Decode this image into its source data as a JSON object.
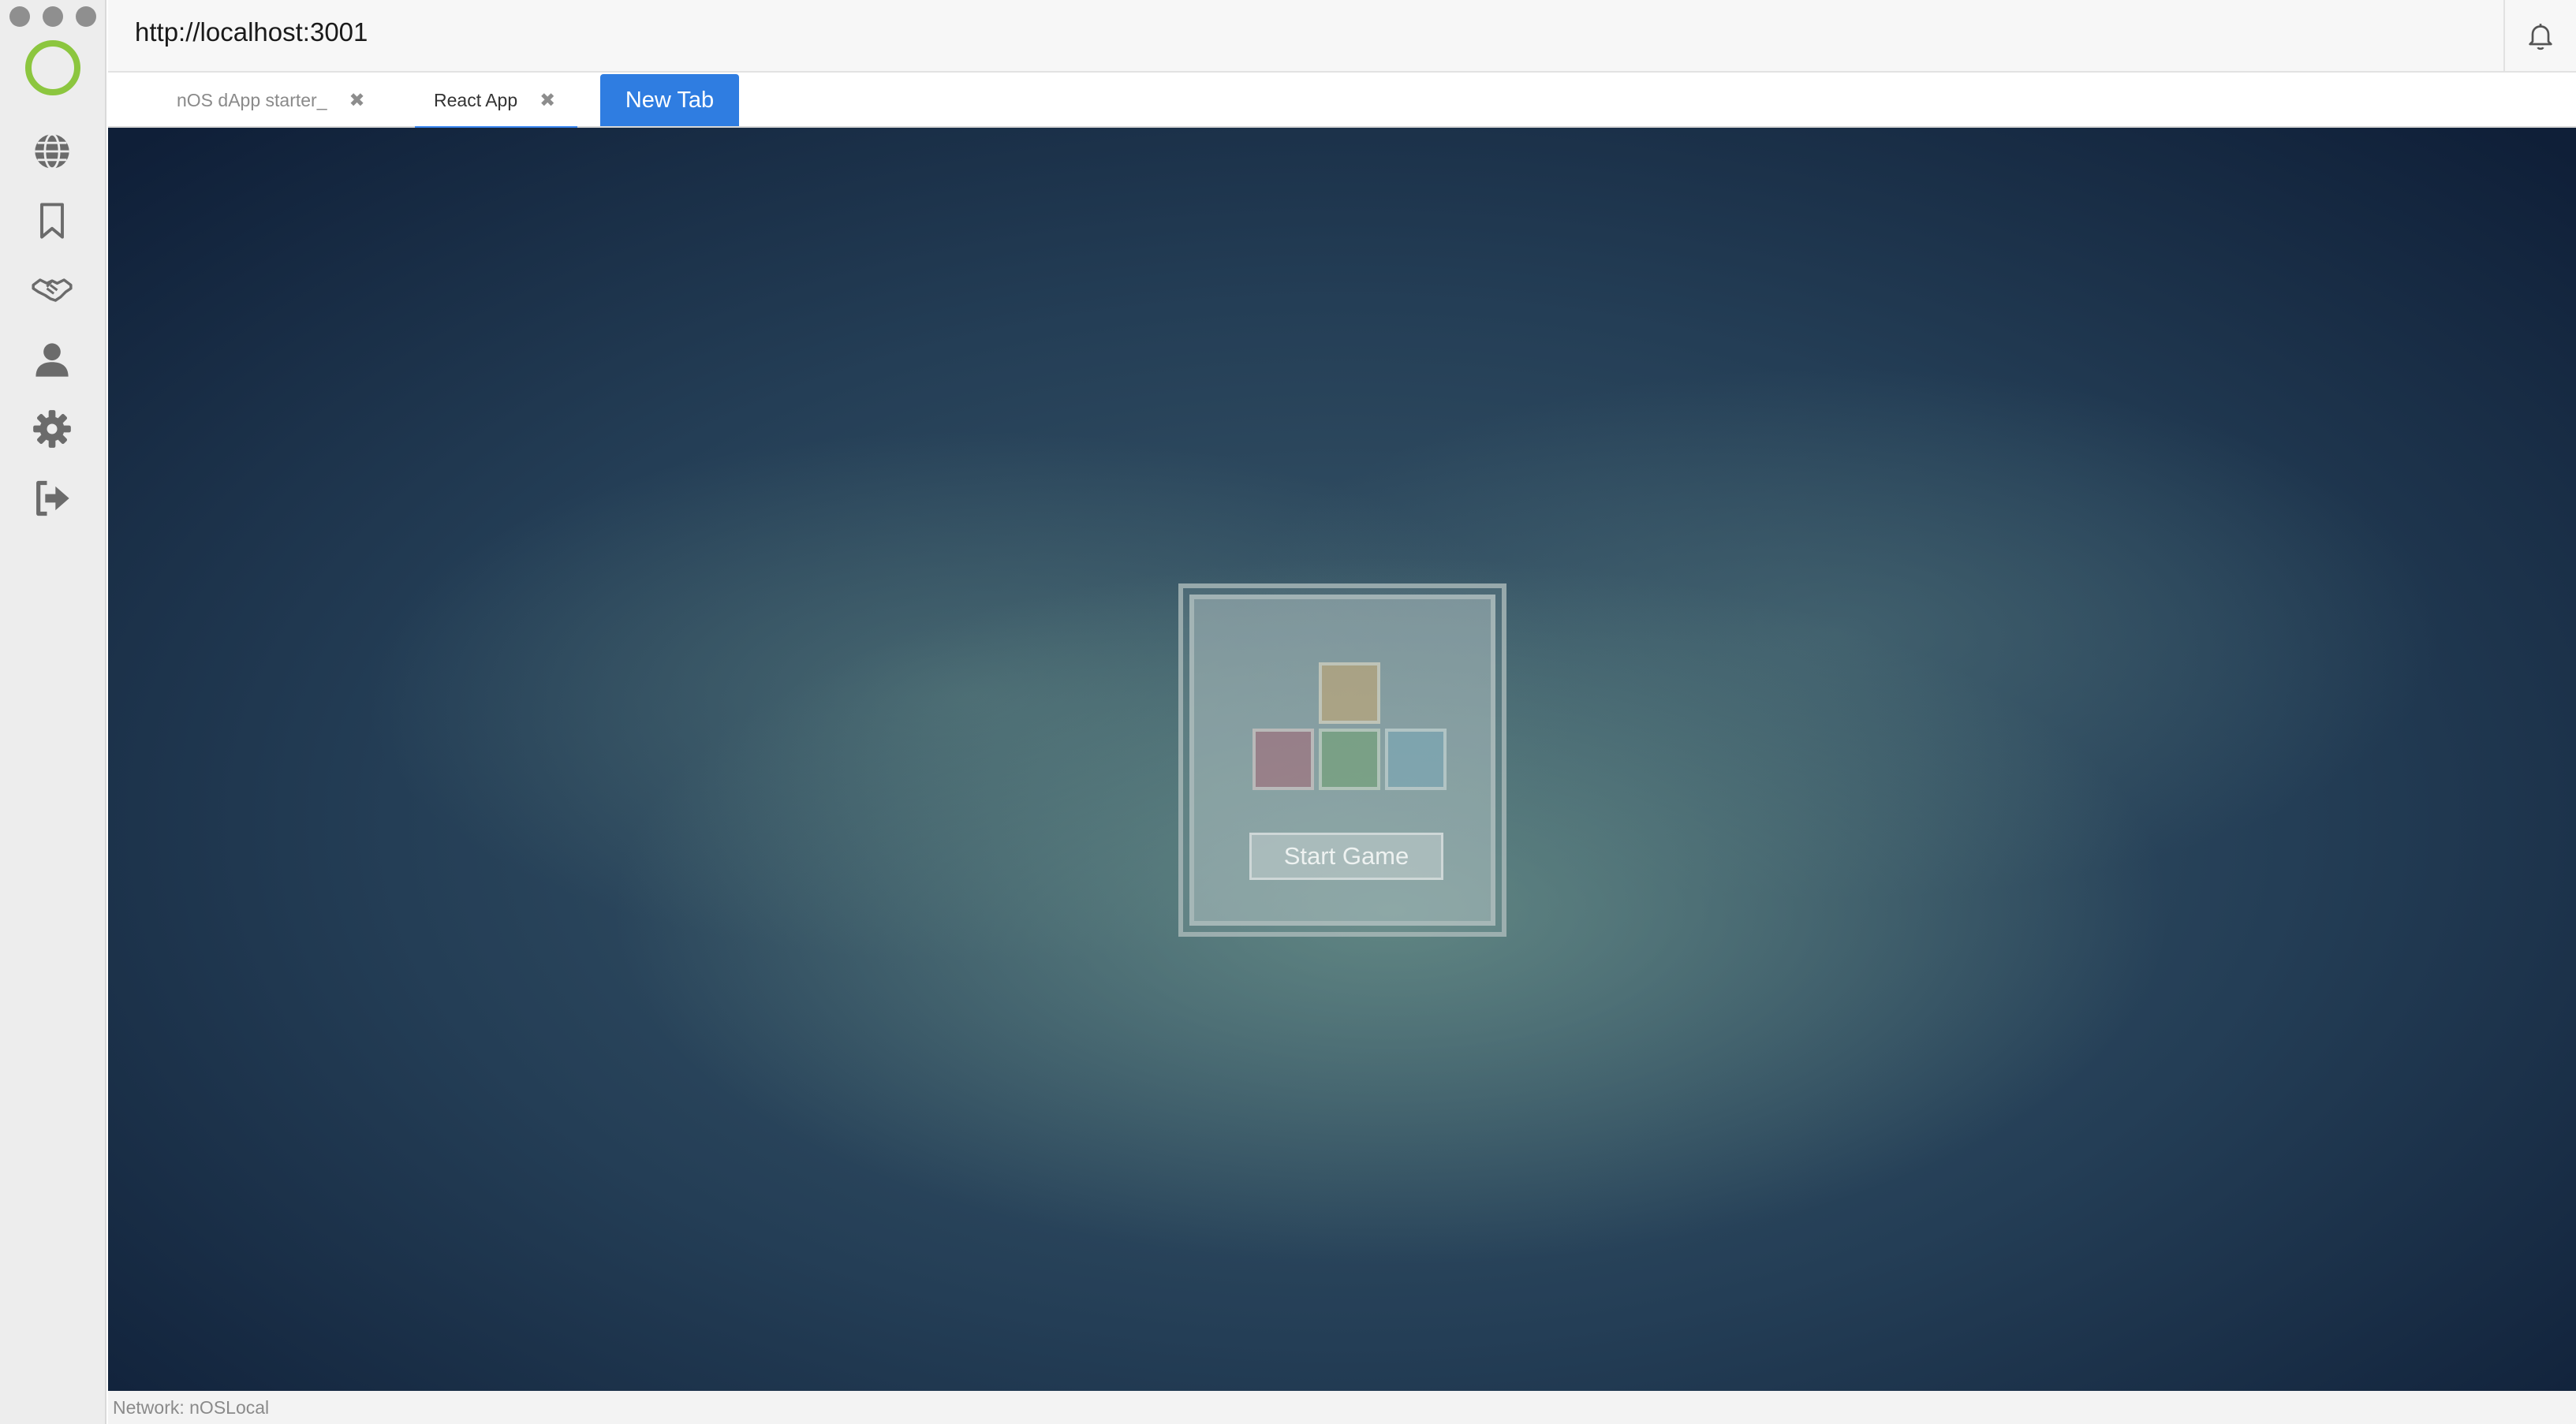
{
  "window": {
    "address": "http://localhost:3001"
  },
  "sidebar": {
    "logo_color": "#8cc63f",
    "icons": [
      "globe-icon",
      "bookmark-icon",
      "handshake-icon",
      "user-icon",
      "gear-icon",
      "logout-icon"
    ]
  },
  "tabs": [
    {
      "label": "nOS dApp starter_",
      "active": false
    },
    {
      "label": "React App",
      "active": true
    }
  ],
  "new_tab_label": "New Tab",
  "game": {
    "start_label": "Start Game",
    "block_colors": [
      "#c8a870",
      "#a86070",
      "#70a070",
      "#78a8b8"
    ]
  },
  "status": {
    "network": "Network: nOSLocal"
  },
  "colors": {
    "accent": "#2f7de1",
    "active_tab_underline": "#3a86f0"
  }
}
